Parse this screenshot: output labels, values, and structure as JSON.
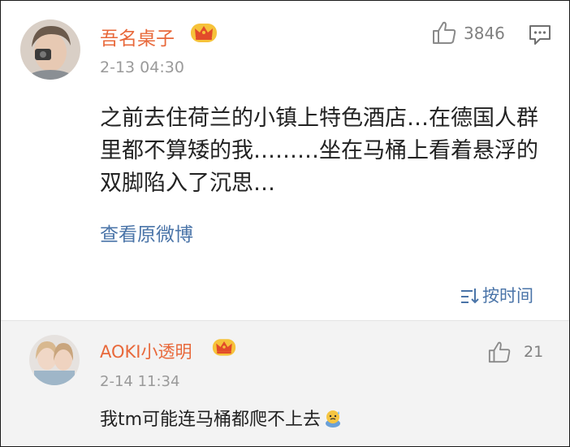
{
  "main_comment": {
    "username": "吾名桌子",
    "time": "2-13 04:30",
    "like_count": "3846",
    "text": "之前去住荷兰的小镇上特色酒店…在德国人群里都不算矮的我………坐在马桶上看着悬浮的双脚陷入了沉思…",
    "view_original": "查看原微博",
    "sort_label": "按时间",
    "icons": [
      "avatar",
      "vip-crown-icon",
      "thumbs-up-icon",
      "comment-icon",
      "sort-icon"
    ]
  },
  "reply": {
    "username": "AOKI小透明",
    "time": "2-14 11:34",
    "like_count": "21",
    "text": "我tm可能连马桶都爬不上去",
    "icons": [
      "avatar",
      "vip-crown-icon",
      "thumbs-up-icon",
      "sweat-emoji-icon"
    ]
  },
  "colors": {
    "username": "#e8683a",
    "link": "#4a74a8",
    "meta": "#9a9a9a",
    "reply_bg": "#f3f3f3"
  }
}
